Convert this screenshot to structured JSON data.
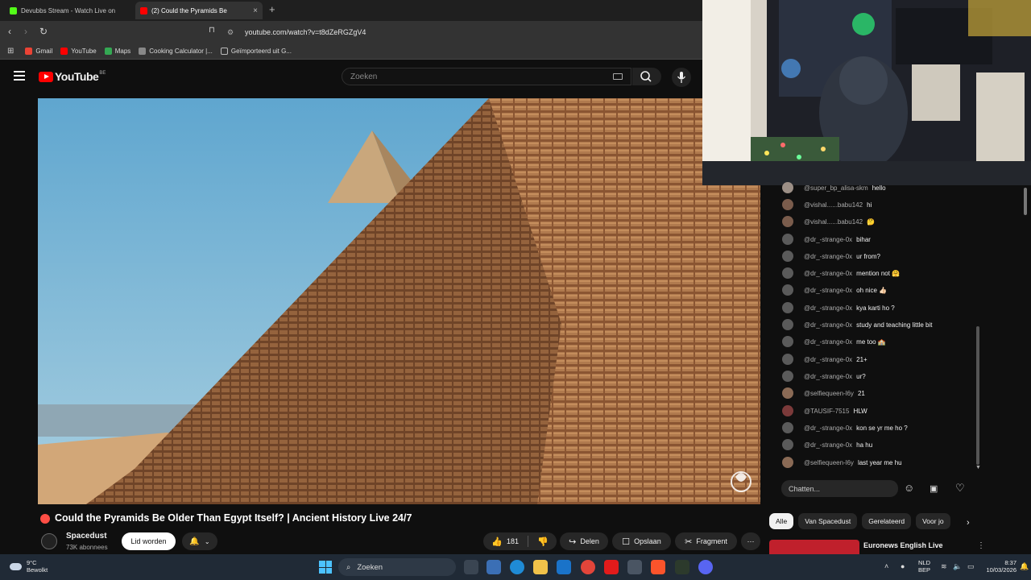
{
  "browser": {
    "tabs": [
      {
        "title": "Devubbs Stream - Watch Live on",
        "fav_color": "#53fc18"
      },
      {
        "title": "(2)  Could the Pyramids Be",
        "fav_color": "#ff0000"
      }
    ],
    "new_tab": "+",
    "close": "×",
    "url": "youtube.com/watch?v=t8dZeRGZgV4",
    "bookmarks": [
      {
        "label": "Gmail",
        "color": "#ea4335"
      },
      {
        "label": "YouTube",
        "color": "#ff0000"
      },
      {
        "label": "Maps",
        "color": "#34a853"
      },
      {
        "label": "Cooking Calculator |...",
        "color": "#888888"
      },
      {
        "label": "Geïmporteerd uit G...",
        "color": "#aaaaaa"
      }
    ]
  },
  "yt": {
    "logo": "YouTube",
    "country": "BE",
    "search_placeholder": "Zoeken"
  },
  "video": {
    "title": "Could the Pyramids Be Older Than Egypt Itself? | Ancient History Live 24/7",
    "channel": "Spacedust",
    "subscribers": "73K abonnees",
    "join": "Lid worden",
    "likes": "181",
    "share": "Delen",
    "save": "Opslaan",
    "clip": "Fragment",
    "more": "⋯"
  },
  "chat": {
    "messages": [
      {
        "author": "@super_bp_alisa-skm",
        "text": "hello"
      },
      {
        "author": "@vishal......babu142",
        "text": "hi"
      },
      {
        "author": "@vishal......babu142",
        "text": "🤔"
      },
      {
        "author": "@dr_-strange-0x",
        "text": "bihar"
      },
      {
        "author": "@dr_-strange-0x",
        "text": "ur from?"
      },
      {
        "author": "@dr_-strange-0x",
        "text": "mention not 🤗"
      },
      {
        "author": "@dr_-strange-0x",
        "text": "oh nice 👍🏻"
      },
      {
        "author": "@dr_-strange-0x",
        "text": "kya karti ho ?"
      },
      {
        "author": "@dr_-strange-0x",
        "text": "study and teaching little bit"
      },
      {
        "author": "@dr_-strange-0x",
        "text": "me too 🏫"
      },
      {
        "author": "@dr_-strange-0x",
        "text": "21+"
      },
      {
        "author": "@dr_-strange-0x",
        "text": "ur?"
      },
      {
        "author": "@selfiequeen-l6y",
        "text": "21"
      },
      {
        "author": "@TAUSIF-7515",
        "text": "HLW"
      },
      {
        "author": "@dr_-strange-0x",
        "text": "kon se yr me ho ?"
      },
      {
        "author": "@dr_-strange-0x",
        "text": "ha hu"
      },
      {
        "author": "@selfiequeen-l6y",
        "text": "last year me hu"
      }
    ],
    "input_placeholder": "Chatten..."
  },
  "related": {
    "chips": [
      "Alle",
      "Van Spacedust",
      "Gerelateerd",
      "Voor jo"
    ],
    "first_title": "Euronews English Live"
  },
  "taskbar": {
    "temp": "9°C",
    "weather": "Bewolkt",
    "search": "Zoeken",
    "lang1": "NLD",
    "lang2": "BEP",
    "time": "8:37",
    "date": "10/03/2026"
  }
}
